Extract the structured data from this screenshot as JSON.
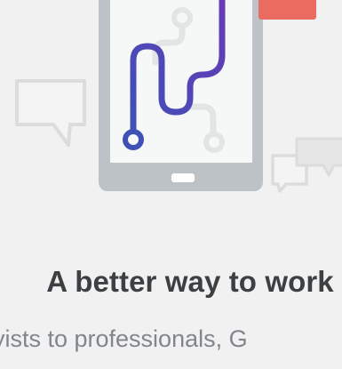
{
  "hero": {
    "heading": "A better way to work",
    "subheading": "yists to professionals, G"
  },
  "colors": {
    "background": "#f1f1f1",
    "device_body": "#bcc2c6",
    "device_screen": "#f6f7f7",
    "path_start": "#3f51b5",
    "path_end": "#673ab7",
    "accent_card": "#ea6b5f",
    "bubble_stroke": "#dadada",
    "heading_text": "#3c4043",
    "subheading_text": "#80868b"
  },
  "icons": [
    "tablet-device-icon",
    "route-path-icon",
    "chat-bubble-icon",
    "chat-bubbles-icon",
    "notification-card-icon"
  ]
}
